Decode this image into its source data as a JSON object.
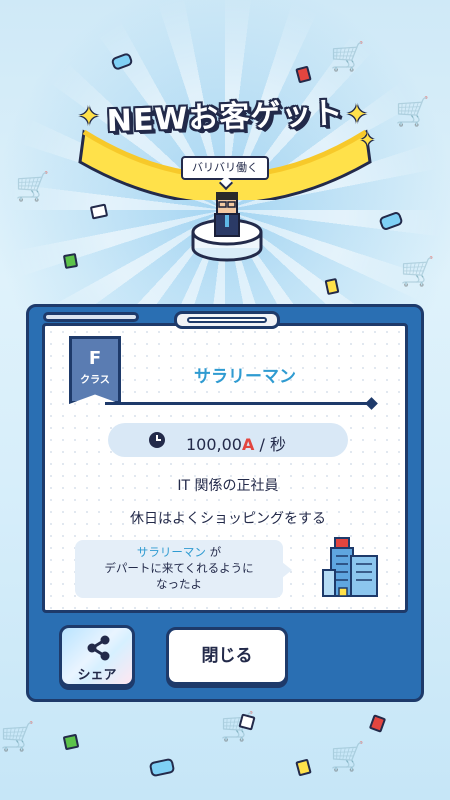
{
  "banner": {
    "title": "NEWお客ゲット"
  },
  "customer": {
    "speech": "バリバリ働く",
    "class_letter": "F",
    "class_label": "クラス",
    "name": "サラリーマン",
    "rate_value": "100,00",
    "rate_unit": "A",
    "rate_suffix": "/ 秒",
    "desc_line1": "IT 関係の正社員",
    "desc_line2": "休日はよくショッピングをする",
    "note_highlight": "サラリーマン",
    "note_line1_rest": " が",
    "note_line2": "デパートに来てくれるように",
    "note_line3": "なったよ"
  },
  "buttons": {
    "share_label": "シェア",
    "close_label": "閉じる"
  },
  "colors": {
    "accent": "#2f9bd1",
    "currency": "#e2453f",
    "panel": "#2a6fb3",
    "ribbon": "#ffe14a"
  },
  "icons": [
    "clock-icon",
    "share-icon",
    "department-store-icon",
    "sparkle-icon"
  ]
}
